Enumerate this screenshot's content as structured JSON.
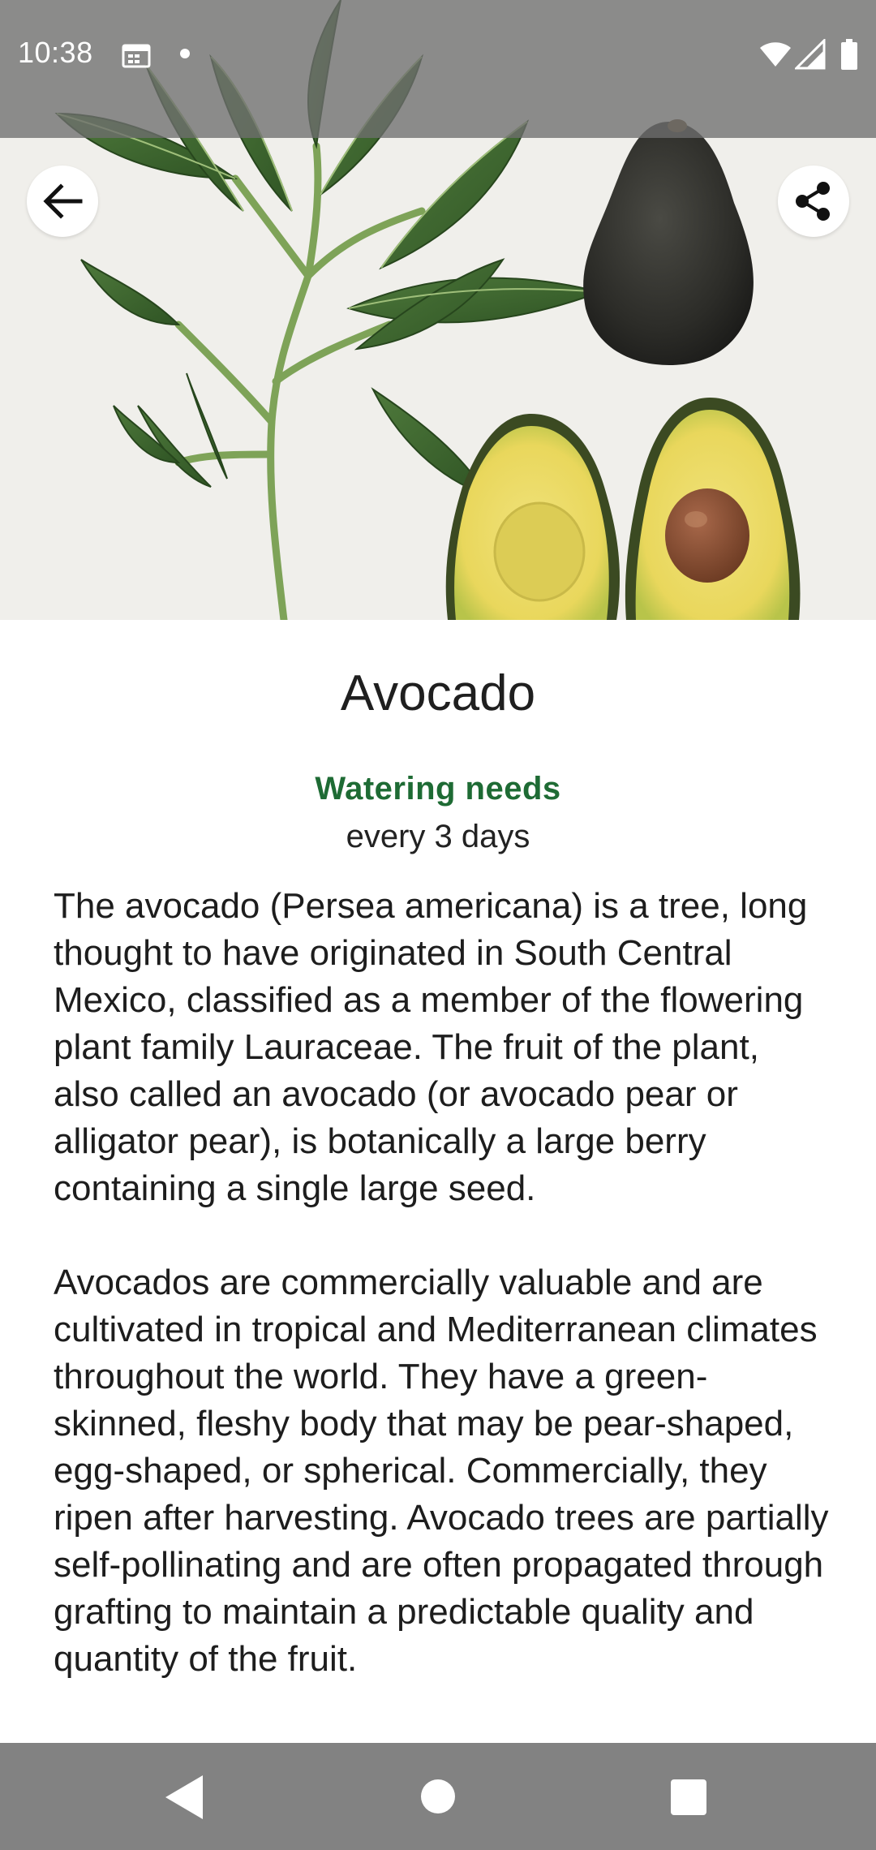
{
  "status_bar": {
    "time": "10:38",
    "icons": [
      "calendar-icon",
      "notification-dot-icon",
      "wifi-icon",
      "cellular-signal-icon",
      "battery-icon"
    ]
  },
  "hero": {
    "subject": "avocado-photo",
    "back_icon": "arrow-back-icon",
    "share_icon": "share-icon"
  },
  "plant": {
    "name": "Avocado",
    "watering_label": "Watering needs",
    "watering_value": "every 3 days",
    "description": "The avocado (Persea americana) is a tree, long thought to have originated in South Central Mexico, classified as a member of the flowering plant family Lauraceae. The fruit of the plant, also called an avocado (or avocado pear or alligator pear), is botanically a large berry containing a single large seed.\n\nAvocados are commercially valuable and are cultivated in tropical and Mediterranean climates throughout the world. They have a green-skinned, fleshy body that may be pear-shaped, egg-shaped, or spherical. Commercially, they ripen after harvesting. Avocado trees are partially self-pollinating and are often propagated through grafting to maintain a predictable quality and quantity of the fruit."
  },
  "nav_bar": {
    "icons": [
      "nav-back-icon",
      "nav-home-icon",
      "nav-recents-icon"
    ]
  },
  "colors": {
    "accent": "#1e6b34",
    "status_bar": "#6e6e6e",
    "nav_bar": "#787878"
  }
}
